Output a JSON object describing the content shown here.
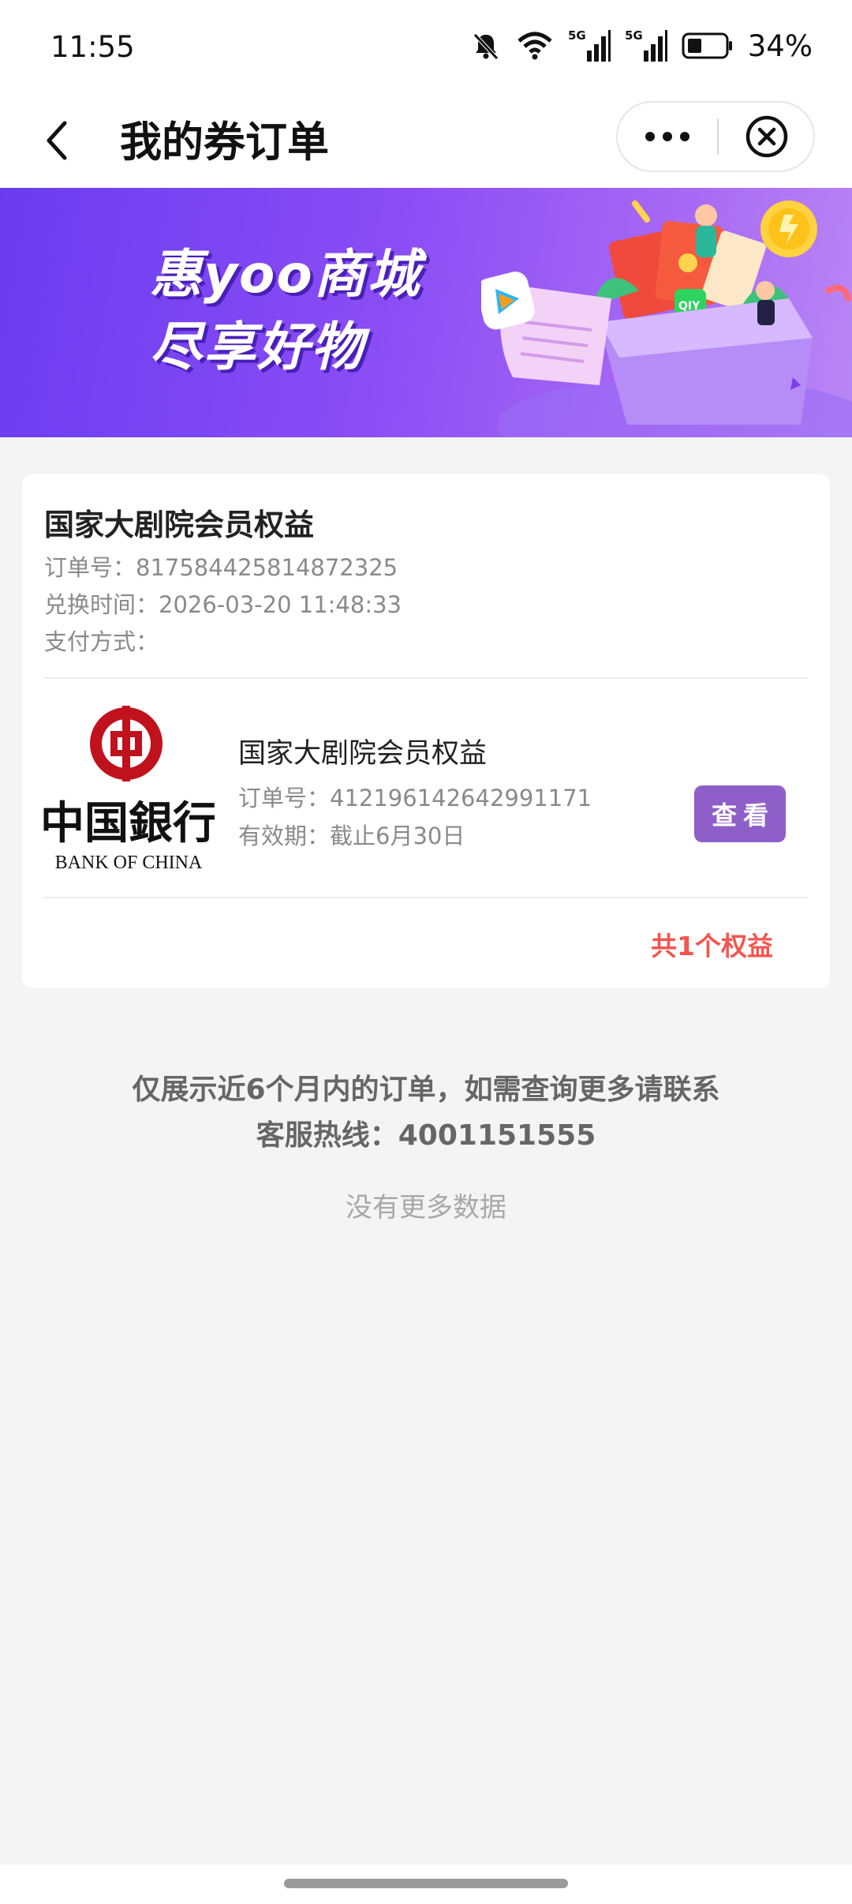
{
  "status_bar": {
    "time": "11:55",
    "battery": "34%",
    "icons": [
      "bell-mute-icon",
      "wifi-icon",
      "signal-5g-icon",
      "signal-5g-icon",
      "battery-icon"
    ]
  },
  "nav": {
    "title": "我的券订单",
    "back_icon": "chevron-left-icon",
    "more_icon": "more-dots-icon",
    "close_icon": "close-circle-icon"
  },
  "banner": {
    "line1": "惠yoo商城",
    "line2": "尽享好物",
    "accent": "#7a45f2"
  },
  "order": {
    "title": "国家大剧院会员权益",
    "order_no": "订单号：817584425814872325",
    "exchange_time": "兑换时间：2026-03-20 11:48:33",
    "payment": "支付方式：",
    "item": {
      "logo_alt": "BANK OF CHINA",
      "logo_cn": "中国銀行",
      "title": "国家大剧院会员权益",
      "order_no": "订单号：412196142642991171",
      "validity": "有效期：截止6月30日",
      "view_label": "查看"
    },
    "total": "共1个权益"
  },
  "notice": {
    "line1": "仅展示近6个月内的订单，如需查询更多请联系",
    "line2": "客服热线：4001151555",
    "no_more": "没有更多数据"
  },
  "colors": {
    "accent_purple": "#8f5fc9",
    "total_red": "#f2564f",
    "boc_red": "#c0121d"
  }
}
